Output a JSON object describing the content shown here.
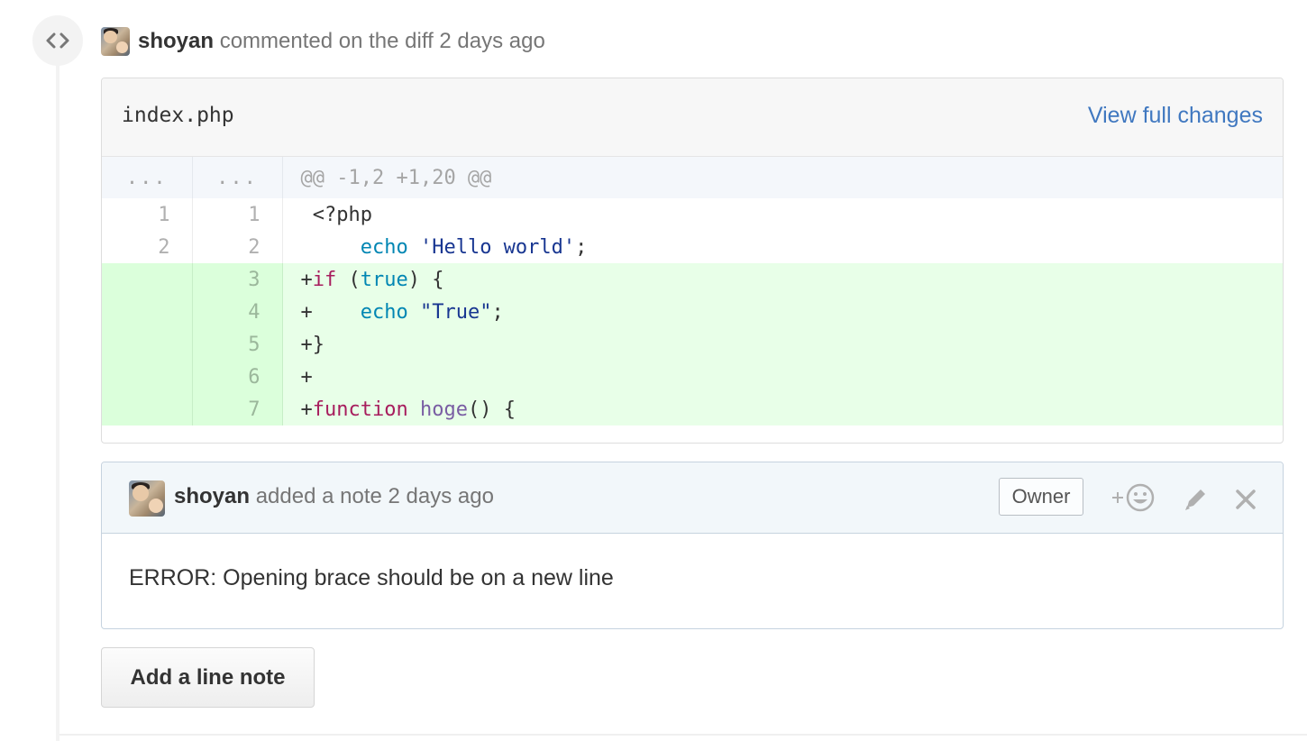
{
  "event": {
    "author": "shoyan",
    "action_text": " commented on the diff 2 days ago"
  },
  "diff": {
    "file_name": "index.php",
    "view_full_changes": "View full changes",
    "hunk": {
      "old_ln": "...",
      "new_ln": "...",
      "header": "@@ -1,2 +1,20 @@"
    },
    "lines": [
      {
        "old": "1",
        "new": "1"
      },
      {
        "old": "2",
        "new": "2"
      },
      {
        "old": "",
        "new": "3"
      },
      {
        "old": "",
        "new": "4"
      },
      {
        "old": "",
        "new": "5"
      },
      {
        "old": "",
        "new": "6"
      },
      {
        "old": "",
        "new": "7"
      }
    ]
  },
  "note": {
    "author": "shoyan",
    "action_text": " added a note 2 days ago",
    "owner_badge": "Owner",
    "body": "ERROR: Opening brace should be on a new line",
    "icons": [
      "add-reaction-icon",
      "pencil-icon",
      "close-icon"
    ]
  },
  "actions": {
    "add_line_note": "Add a line note"
  },
  "colors": {
    "link": "#4078c0",
    "addition_bg": "#e8ffe8",
    "hunk_bg": "#f4f7fb",
    "note_header_bg": "#f2f7fa"
  }
}
